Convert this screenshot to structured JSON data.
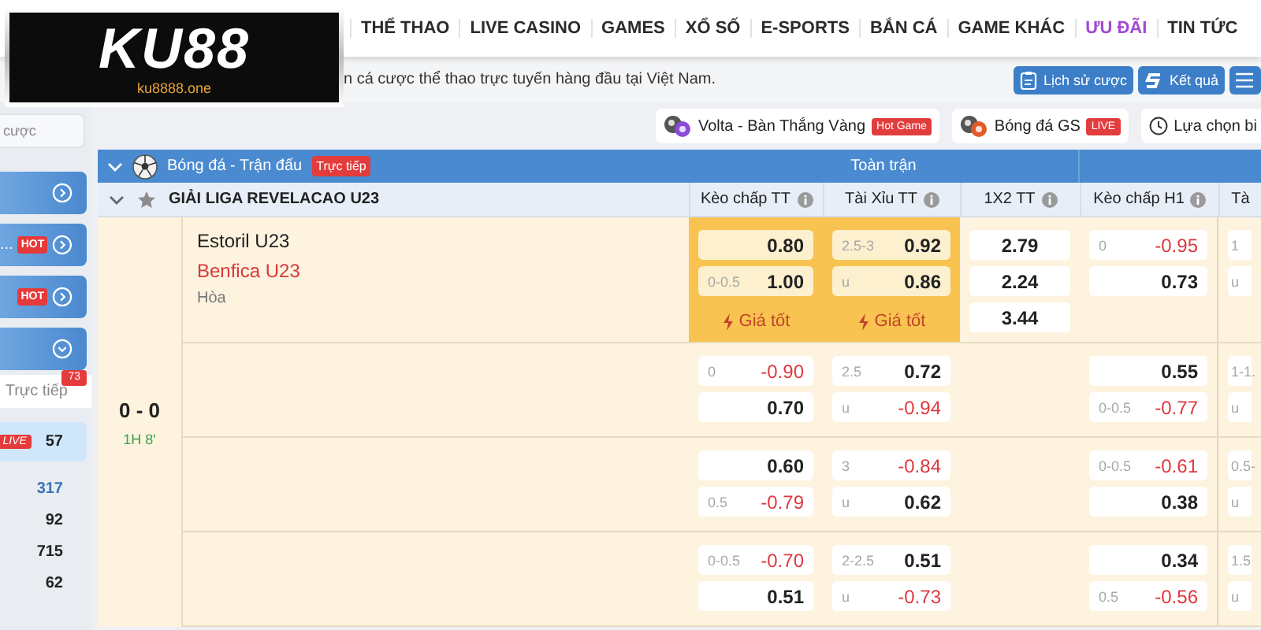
{
  "logo": {
    "name": "KU88",
    "domain": "ku8888.one"
  },
  "nav": [
    {
      "label": "THỂ THAO",
      "selected": false
    },
    {
      "label": "LIVE CASINO",
      "selected": false
    },
    {
      "label": "GAMES",
      "selected": false
    },
    {
      "label": "XỔ SỐ",
      "selected": false
    },
    {
      "label": "E-SPORTS",
      "selected": false
    },
    {
      "label": "BẮN CÁ",
      "selected": false
    },
    {
      "label": "GAME KHÁC",
      "selected": false
    },
    {
      "label": "ƯU ĐÃI",
      "selected": true
    },
    {
      "label": "TIN TỨC",
      "selected": false
    }
  ],
  "ticker": {
    "text": "n cá cược thể thao trực tuyến hàng đầu tại Việt Nam."
  },
  "actions": [
    {
      "kind": "history",
      "label": "Lịch sử cược"
    },
    {
      "kind": "results",
      "label": "Kết quả"
    },
    {
      "kind": "menu"
    }
  ],
  "sidebar": {
    "field": {
      "value": "cược"
    },
    "items": [
      {
        "kind": "go"
      },
      {
        "kind": "go",
        "label": "...",
        "badge": "HOT"
      },
      {
        "kind": "go",
        "badge": "HOT"
      },
      {
        "kind": "expand"
      }
    ],
    "live": {
      "label": "Trực tiếp",
      "count": "73"
    },
    "sports": [
      {
        "badge": "LIVE",
        "count": "57",
        "selected": true,
        "emphasis": false
      },
      {
        "count": "317",
        "selected": false,
        "emphasis": true
      },
      {
        "count": "92",
        "selected": false,
        "emphasis": false
      },
      {
        "count": "715",
        "selected": false,
        "emphasis": false
      },
      {
        "count": "62",
        "selected": false,
        "emphasis": false
      }
    ]
  },
  "quick": [
    {
      "kind": "volta",
      "label": "Volta - Bàn Thắng Vàng",
      "badge": "Hot Game"
    },
    {
      "kind": "gs",
      "label": "Bóng đá GS",
      "badge": "LIVE"
    },
    {
      "kind": "picker",
      "label": "Lựa chọn bi"
    }
  ],
  "section": {
    "title": "Bóng đá - Trận đấu",
    "badge": "Trực tiếp",
    "expanded": true,
    "group": "Toàn trận"
  },
  "league": {
    "name": "GIẢI LIGA REVELACAO U23",
    "expanded": true,
    "starred": false,
    "columns": [
      "Kèo chấp TT",
      "Tài Xỉu TT",
      "1X2 TT",
      "Kèo chấp H1",
      "Tà"
    ]
  },
  "match": {
    "score": "0 - 0",
    "clock": "1H 8'",
    "home": "Estoril U23",
    "away": "Benfica U23",
    "draw": "Hòa",
    "rows": [
      {
        "handicap": {
          "best": true,
          "tag": "Giá tốt",
          "prices": [
            {
              "odds": "0.80",
              "negative": false
            },
            {
              "line": "0-0.5",
              "odds": "1.00",
              "negative": false
            }
          ]
        },
        "total": {
          "best": true,
          "tag": "Giá tốt",
          "prices": [
            {
              "line": "2.5-3",
              "odds": "0.92",
              "negative": false
            },
            {
              "line": "u",
              "odds": "0.86",
              "negative": false
            }
          ]
        },
        "x12": [
          "2.79",
          "2.24",
          "3.44"
        ],
        "h1_handicap": {
          "best": false,
          "prices": [
            {
              "line": "0",
              "odds": "-0.95",
              "negative": true
            },
            {
              "odds": "0.73",
              "negative": false
            }
          ]
        },
        "h1_total": {
          "best": false,
          "prices": [
            {
              "line": "1"
            },
            {
              "line": "u"
            }
          ]
        }
      },
      {
        "handicap": {
          "best": false,
          "prices": [
            {
              "line": "0",
              "odds": "-0.90",
              "negative": true
            },
            {
              "odds": "0.70",
              "negative": false
            }
          ]
        },
        "total": {
          "best": false,
          "prices": [
            {
              "line": "2.5",
              "odds": "0.72",
              "negative": false
            },
            {
              "line": "u",
              "odds": "-0.94",
              "negative": true
            }
          ]
        },
        "h1_handicap": {
          "best": false,
          "prices": [
            {
              "odds": "0.55",
              "negative": false
            },
            {
              "line": "0-0.5",
              "odds": "-0.77",
              "negative": true
            }
          ]
        },
        "h1_total": {
          "best": false,
          "prices": [
            {
              "line": "1-1."
            },
            {
              "line": "u"
            }
          ]
        }
      },
      {
        "handicap": {
          "best": false,
          "prices": [
            {
              "odds": "0.60",
              "negative": false
            },
            {
              "line": "0.5",
              "odds": "-0.79",
              "negative": true
            }
          ]
        },
        "total": {
          "best": false,
          "prices": [
            {
              "line": "3",
              "odds": "-0.84",
              "negative": true
            },
            {
              "line": "u",
              "odds": "0.62",
              "negative": false
            }
          ]
        },
        "h1_handicap": {
          "best": false,
          "prices": [
            {
              "line": "0-0.5",
              "odds": "-0.61",
              "negative": true
            },
            {
              "odds": "0.38",
              "negative": false
            }
          ]
        },
        "h1_total": {
          "best": false,
          "prices": [
            {
              "line": "0.5-"
            },
            {
              "line": "u"
            }
          ]
        }
      },
      {
        "handicap": {
          "best": false,
          "prices": [
            {
              "line": "0-0.5",
              "odds": "-0.70",
              "negative": true
            },
            {
              "odds": "0.51",
              "negative": false
            }
          ]
        },
        "total": {
          "best": false,
          "prices": [
            {
              "line": "2-2.5",
              "odds": "0.51",
              "negative": false
            },
            {
              "line": "u",
              "odds": "-0.73",
              "negative": true
            }
          ]
        },
        "h1_handicap": {
          "best": false,
          "prices": [
            {
              "odds": "0.34",
              "negative": false
            },
            {
              "line": "0.5",
              "odds": "-0.56",
              "negative": true
            }
          ]
        },
        "h1_total": {
          "best": false,
          "prices": [
            {
              "line": "1.5"
            },
            {
              "line": "u"
            }
          ]
        }
      }
    ]
  }
}
